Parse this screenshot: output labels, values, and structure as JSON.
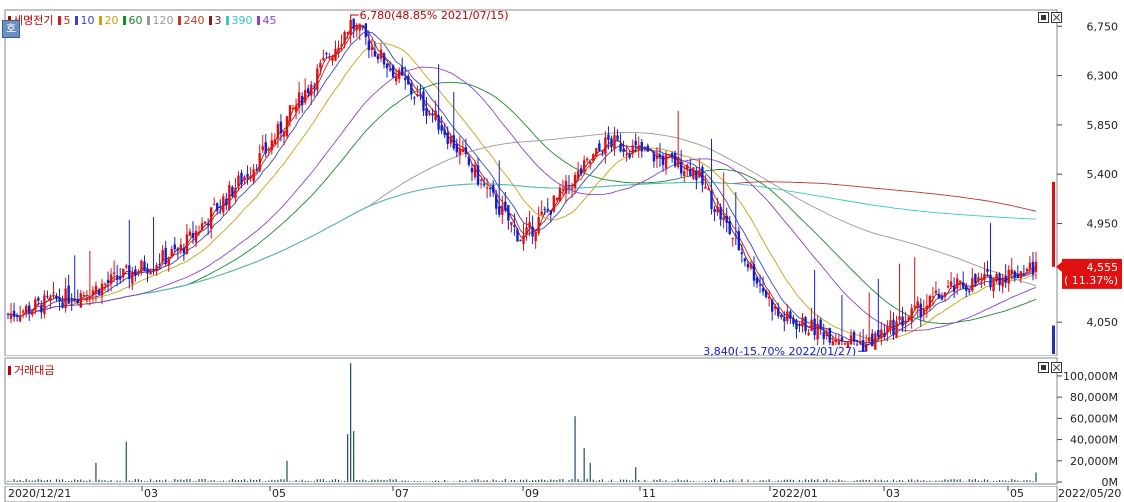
{
  "chart_data": [
    {
      "type": "candlestick",
      "title": "세명전기",
      "moving_averages": [
        {
          "period": "5",
          "color": "#d21f1f"
        },
        {
          "period": "10",
          "color": "#3a44c8"
        },
        {
          "period": "20",
          "color": "#d0a010"
        },
        {
          "period": "60",
          "color": "#1a8a2a"
        },
        {
          "period": "120",
          "color": "#999999"
        },
        {
          "period": "240",
          "color": "#c0392b"
        },
        {
          "period": "3",
          "color": "#8b1a1a"
        },
        {
          "period": "390",
          "color": "#3cc8c8"
        },
        {
          "period": "45",
          "color": "#8e44c8"
        }
      ],
      "y_ticks": [
        "6,750",
        "6,300",
        "5,850",
        "5,400",
        "4,950",
        "4,050"
      ],
      "ylim": [
        3760,
        6880
      ],
      "x_labels": [
        "2020/12/21",
        "03",
        "05",
        "07",
        "09",
        "11",
        "2022/01",
        "03",
        "05",
        "2022/05/20"
      ],
      "annotations": {
        "high": "6,780(48.85% 2021/07/15)",
        "low": "3,840(-15.70% 2022/01/27)"
      },
      "current_price": "4,555",
      "current_change": "( 11.37%)",
      "key_points": [
        {
          "date": "2020/12/21",
          "close": 4120
        },
        {
          "date": "2021/03",
          "close": 4350
        },
        {
          "date": "2021/05",
          "close": 4700
        },
        {
          "date": "2021/06",
          "close": 5600
        },
        {
          "date": "2021/07/15",
          "high": 6780
        },
        {
          "date": "2021/08",
          "close": 5900
        },
        {
          "date": "2021/09",
          "close": 4800
        },
        {
          "date": "2021/10",
          "close": 5700
        },
        {
          "date": "2021/11",
          "close": 5450
        },
        {
          "date": "2021/12",
          "close": 4100
        },
        {
          "date": "2022/01/27",
          "low": 3840
        },
        {
          "date": "2022/03",
          "close": 4350
        },
        {
          "date": "2022/05/20",
          "close": 4555
        }
      ]
    },
    {
      "type": "bar",
      "title": "거래대금",
      "y_ticks": [
        "100,000M",
        "80,000M",
        "60,000M",
        "40,000M",
        "20,000M",
        "0M"
      ],
      "ylim": [
        0,
        115000
      ],
      "unit": "M"
    }
  ],
  "colors": {
    "up": "#e01010",
    "down": "#1020d0",
    "volume": "#1d4e66"
  }
}
